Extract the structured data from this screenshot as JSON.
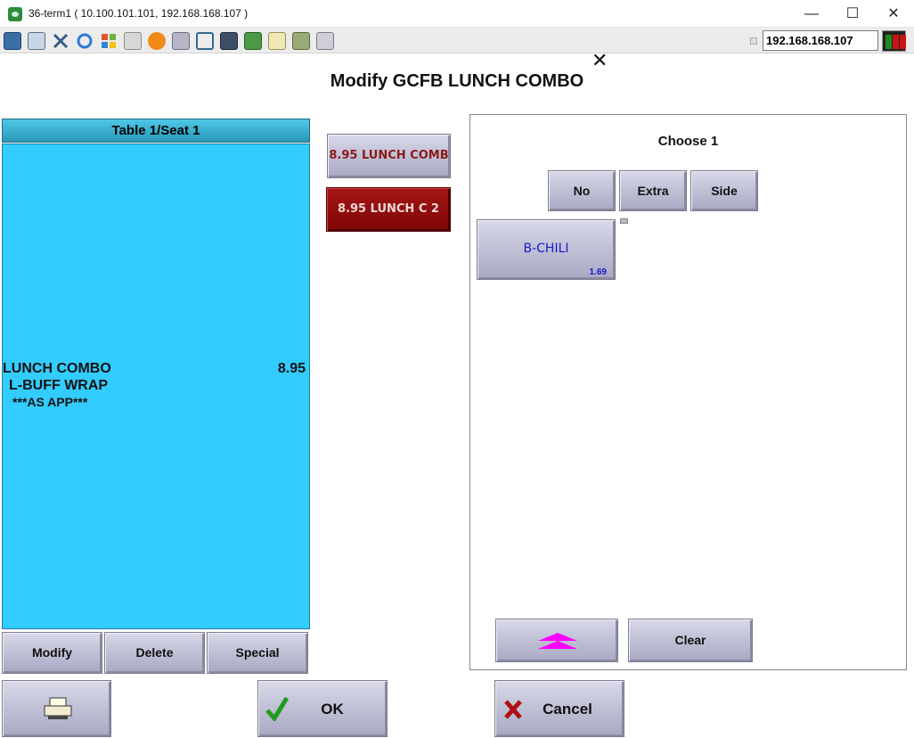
{
  "window": {
    "title": "36-term1 ( 10.100.101.101, 192.168.168.107 )",
    "minimize_glyph": "—",
    "maximize_glyph": "☐",
    "close_glyph": "✕"
  },
  "toolbar": {
    "icons": [
      "monitor-icon",
      "copy-icon",
      "tools-icon",
      "refresh-icon",
      "windows-icon",
      "keyboard-icon",
      "warning-icon",
      "network-icon",
      "fullscreen-icon",
      "display-icon",
      "download-icon",
      "notepad-icon",
      "screenshot-icon",
      "chat-icon"
    ],
    "ip_address": "192.168.168.107"
  },
  "dialog": {
    "close_glyph": "✕",
    "title": "Modify GCFB LUNCH COMBO"
  },
  "order": {
    "header": "Table 1/Seat 1",
    "item_name": "LUNCH COMBO",
    "item_price": "8.95",
    "modifiers": [
      "L-BUFF WRAP",
      "***AS APP***"
    ]
  },
  "combo_buttons": [
    "8.95 LUNCH COMB",
    "8.95 LUNCH C 2"
  ],
  "choices": {
    "heading": "Choose 1",
    "modifier_types": [
      "No",
      "Extra",
      "Side"
    ],
    "option": {
      "label": "B-CHILI",
      "price": "1.69"
    },
    "clear_label": "Clear"
  },
  "actions": {
    "modify": "Modify",
    "delete": "Delete",
    "special": "Special",
    "ok": "OK",
    "cancel": "Cancel"
  },
  "colors": {
    "order_background": "#33ccff",
    "selected_combo": "#8b0a0a",
    "option_text": "#1a1acc",
    "arrow": "#ff00ff"
  }
}
